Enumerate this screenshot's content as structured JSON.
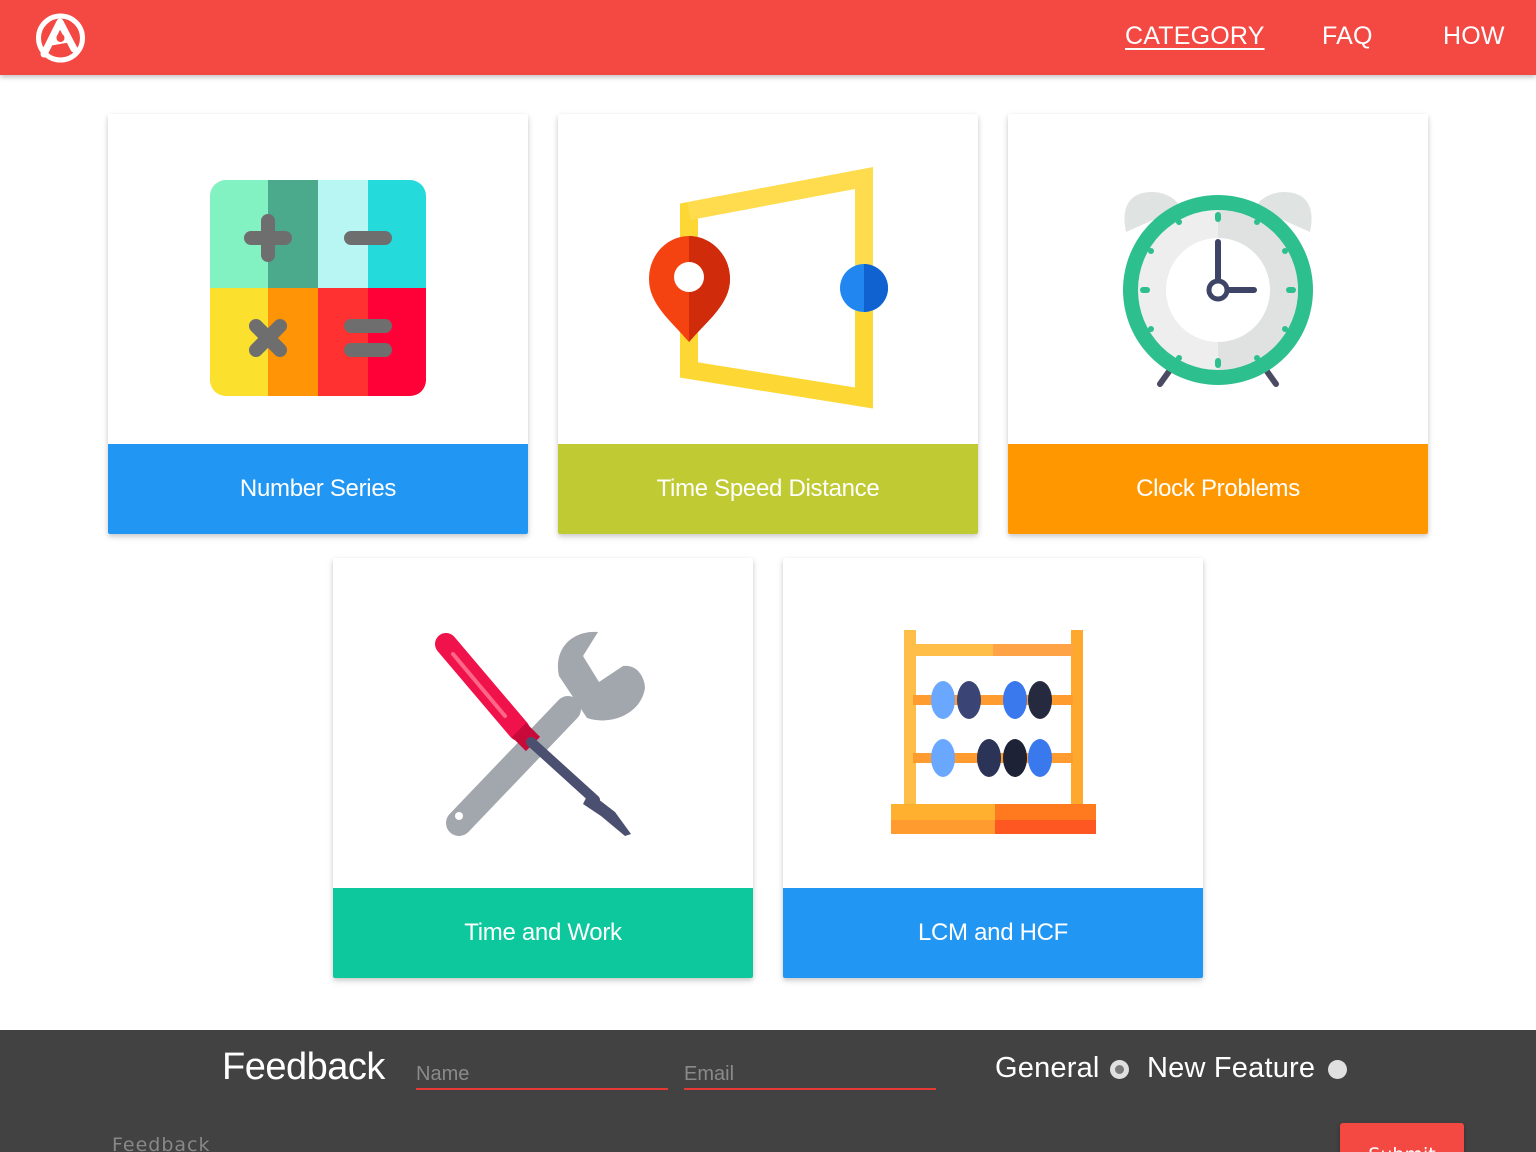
{
  "navbar": {
    "background": "#f44842",
    "logo_icon": "logo-a-icon",
    "links": [
      {
        "label": "CATEGORY",
        "active": true
      },
      {
        "label": "FAQ",
        "active": false
      },
      {
        "label": "HOW",
        "active": false
      }
    ]
  },
  "categories": [
    {
      "label": "Number Series",
      "color": "#2196f3",
      "icon": "calculator-icon"
    },
    {
      "label": "Time Speed Distance",
      "color": "#c0ca33",
      "icon": "map-route-icon"
    },
    {
      "label": "Clock Problems",
      "color": "#ff9800",
      "icon": "alarm-clock-icon"
    },
    {
      "label": "Time and Work",
      "color": "#0dc89c",
      "icon": "tools-icon"
    },
    {
      "label": "LCM and HCF",
      "color": "#2196f3",
      "icon": "abacus-icon"
    }
  ],
  "feedback": {
    "title": "Feedback",
    "name_placeholder": "Name",
    "email_placeholder": "Email",
    "options": [
      {
        "label": "General",
        "checked": true
      },
      {
        "label": "New Feature",
        "checked": false
      }
    ],
    "message_placeholder": "Feedback",
    "submit_label": "Submit",
    "background": "#424242",
    "accent": "#f44842"
  }
}
